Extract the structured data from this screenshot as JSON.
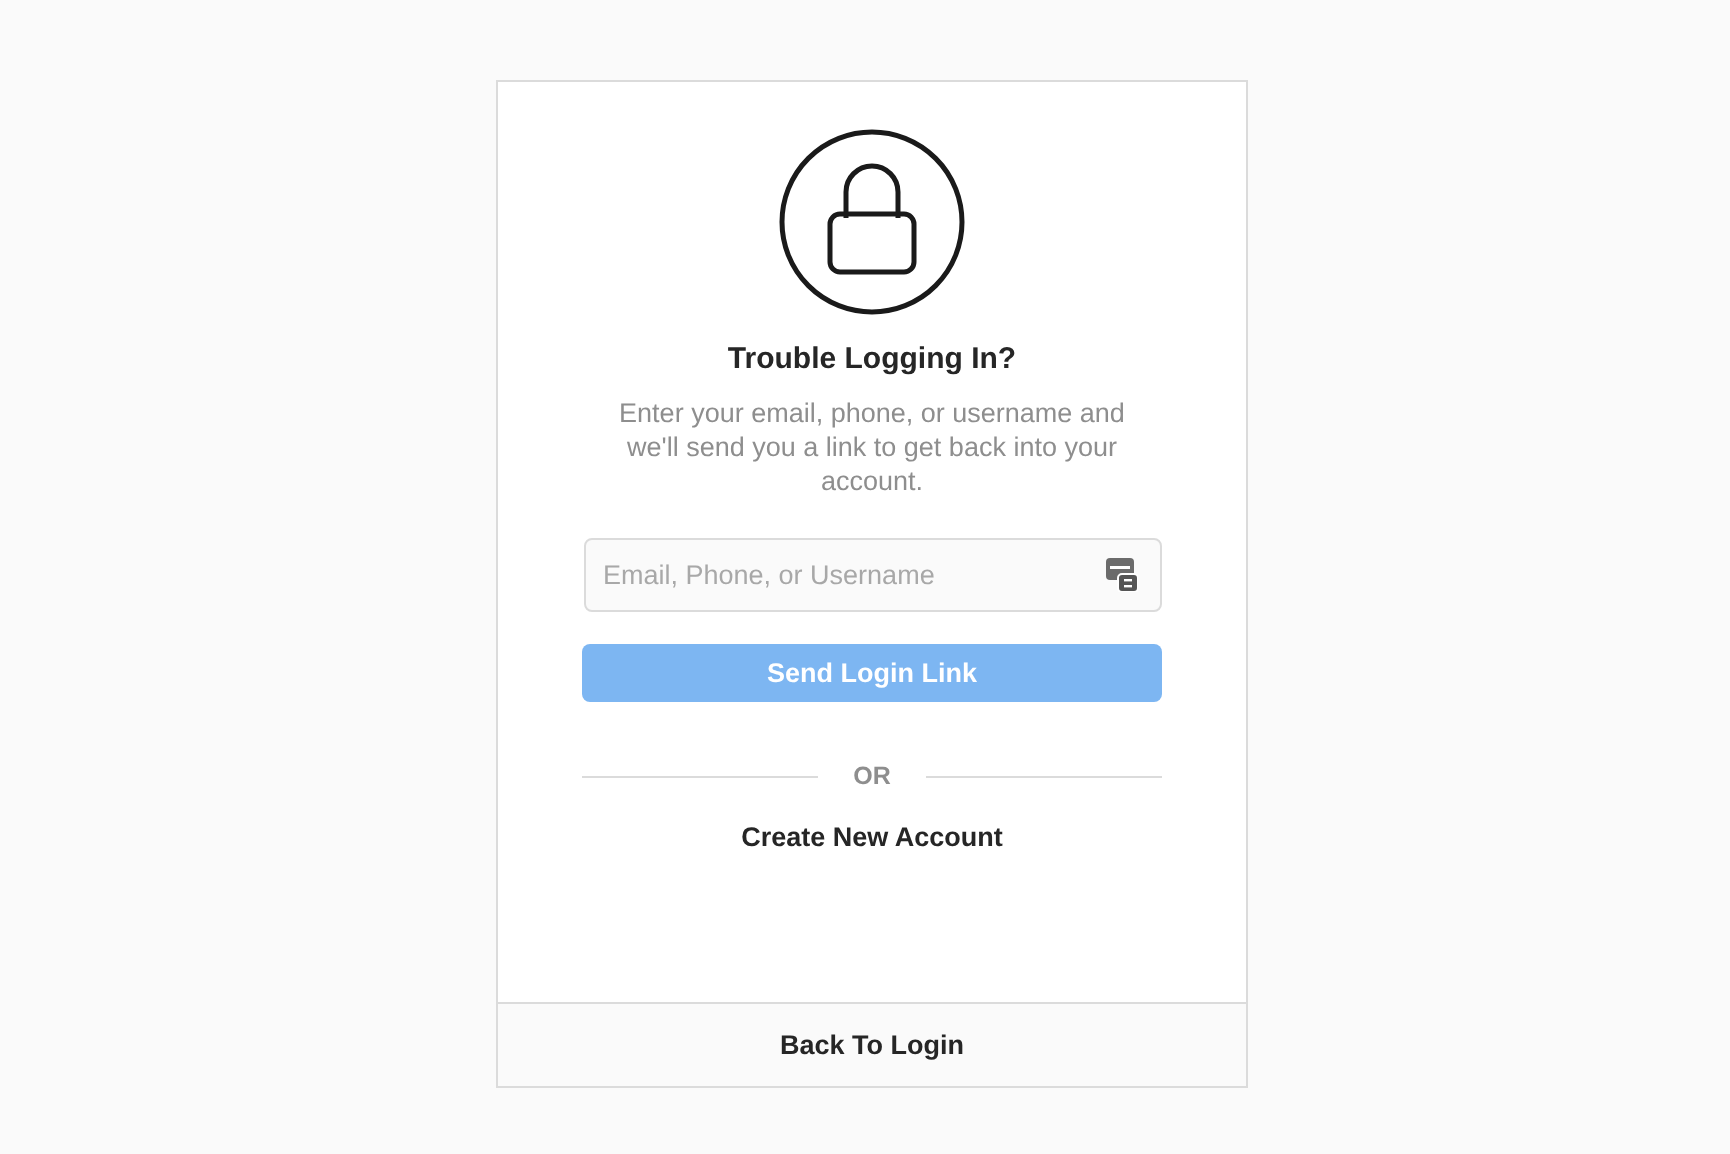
{
  "title": "Trouble Logging In?",
  "description": "Enter your email, phone, or username and we'll send you a link to get back into your account.",
  "login_field": {
    "placeholder": "Email, Phone, or Username"
  },
  "send_button": {
    "label": "Send Login Link",
    "disabled": true
  },
  "divider": "OR",
  "create_account_link": "Create New Account",
  "back_button": "Back To Login"
}
